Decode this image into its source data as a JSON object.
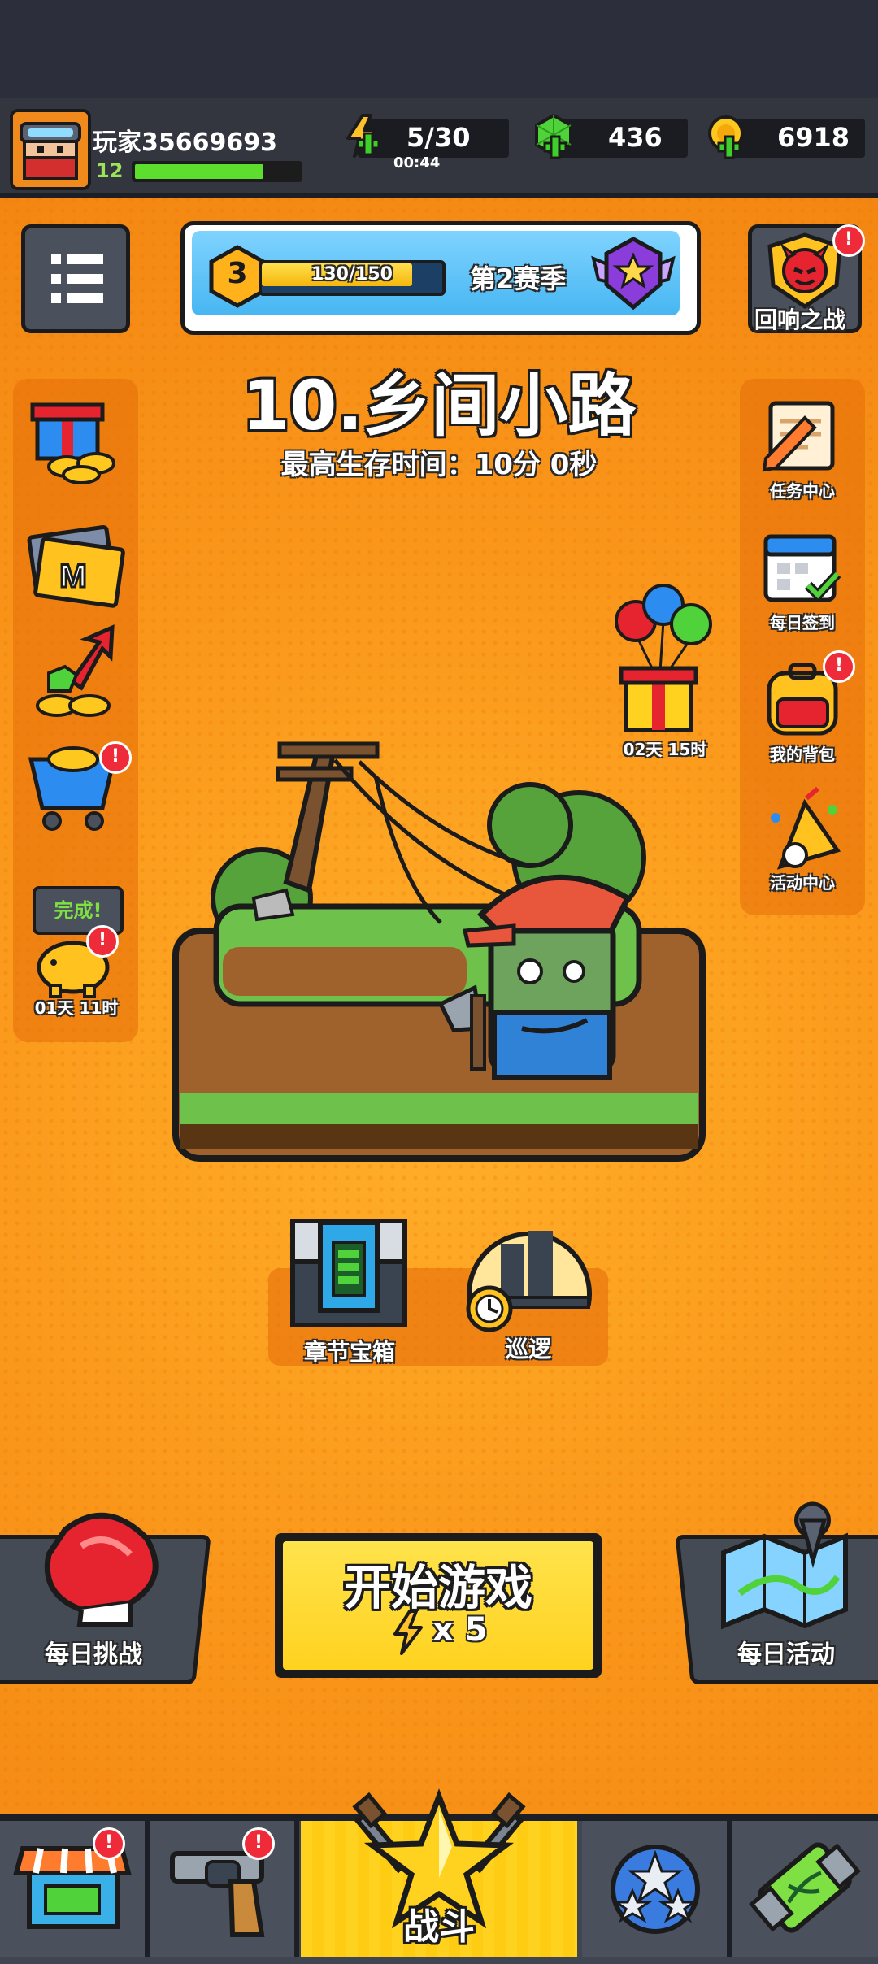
{
  "player": {
    "name": "玩家35669693",
    "level": "12",
    "xp_fraction": 0.78
  },
  "resources": {
    "energy": "5/30",
    "energy_timer": "00:44",
    "gems": "436",
    "coins": "6918"
  },
  "season": {
    "tier": "3",
    "progress": "130/150",
    "progress_fraction": 0.8667,
    "label": "第2赛季"
  },
  "echo_battle": {
    "label": "回响之战",
    "badge": "!"
  },
  "level": {
    "title": "10.乡间小路",
    "best_time": "最高生存时间：10分 0秒"
  },
  "left_sidebar": {
    "piggy_bubble": "完成!",
    "piggy_timer": "01天 11时",
    "badge": "!"
  },
  "right_sidebar": {
    "items": [
      {
        "label": "任务中心",
        "icon": "scroll-pen-icon"
      },
      {
        "label": "每日签到",
        "icon": "calendar-check-icon"
      },
      {
        "label": "我的背包",
        "icon": "backpack-icon"
      },
      {
        "label": "活动中心",
        "icon": "party-popper-icon"
      }
    ],
    "badge": "!"
  },
  "gift_timer": "02天 15时",
  "chapter_chest": {
    "label": "章节宝箱"
  },
  "patrol": {
    "label": "巡逻"
  },
  "daily_challenge": {
    "label": "每日挑战"
  },
  "daily_event": {
    "label": "每日活动"
  },
  "start_game": {
    "label": "开始游戏",
    "cost": "x 5"
  },
  "bottom_nav": {
    "battle_label": "战斗",
    "badge": "!"
  },
  "colors": {
    "background": "#f7931e",
    "bar_dark": "#33363f",
    "accent_yellow": "#ffd21f",
    "badge_red": "#ef2b3a"
  }
}
